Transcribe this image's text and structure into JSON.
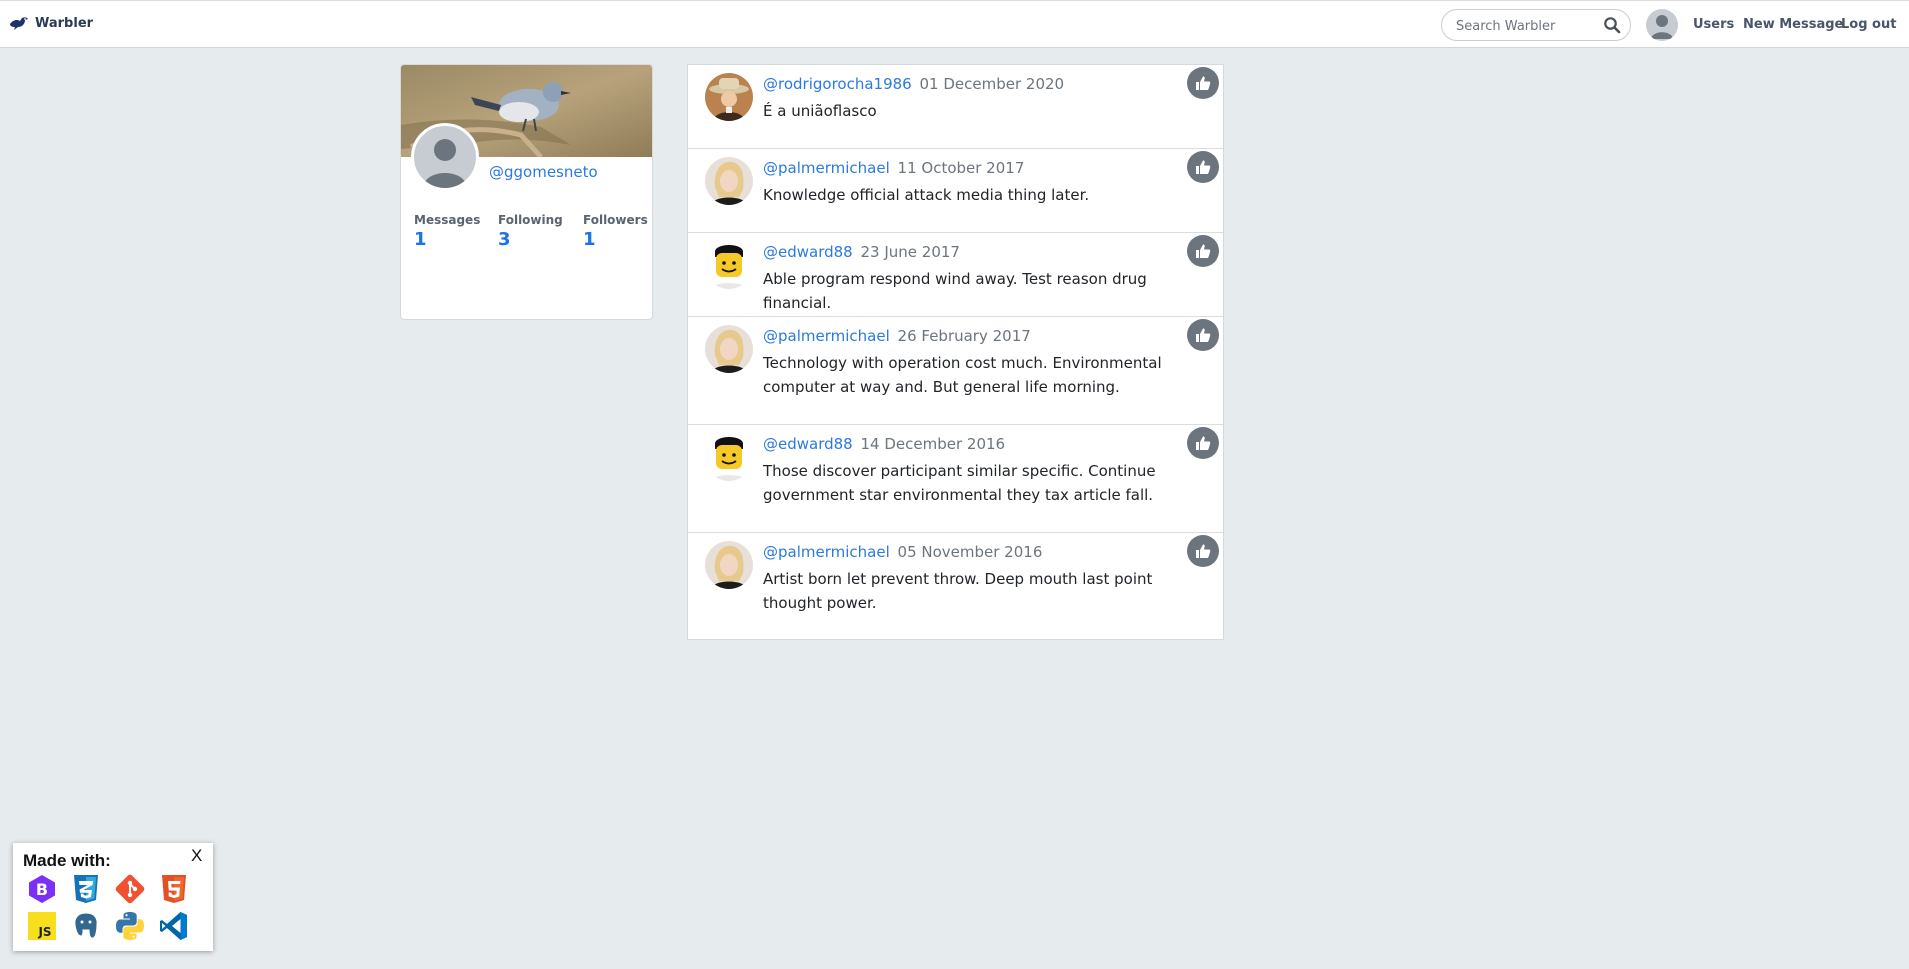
{
  "navbar": {
    "brand": "Warbler",
    "search_placeholder": "Search Warbler",
    "links": {
      "users": "Users",
      "new_message": "New Message",
      "logout": "Log out"
    }
  },
  "profile": {
    "username": "@ggomesneto",
    "stats": [
      {
        "label": "Messages",
        "value": "1"
      },
      {
        "label": "Following",
        "value": "3"
      },
      {
        "label": "Followers",
        "value": "1"
      }
    ]
  },
  "messages": [
    {
      "user": "@rodrigorocha1986",
      "date": "01 December 2020",
      "text": "É a uniãoflasco",
      "avatar": "cowboy-hat-avatar"
    },
    {
      "user": "@palmermichael",
      "date": "11 October 2017",
      "text": "Knowledge official attack media thing later.",
      "avatar": "blonde-woman-avatar"
    },
    {
      "user": "@edward88",
      "date": "23 June 2017",
      "text": "Able program respond wind away. Test reason drug financial.",
      "avatar": "lego-minifigure-avatar"
    },
    {
      "user": "@palmermichael",
      "date": "26 February 2017",
      "text": "Technology with operation cost much. Environmental computer at way and. But general life morning.",
      "avatar": "blonde-woman-avatar"
    },
    {
      "user": "@edward88",
      "date": "14 December 2016",
      "text": "Those discover participant similar specific. Continue government star environmental they tax article fall.",
      "avatar": "lego-minifigure-avatar"
    },
    {
      "user": "@palmermichael",
      "date": "05 November 2016",
      "text": "Artist born let prevent throw. Deep mouth last point thought power.",
      "avatar": "blonde-woman-avatar"
    }
  ],
  "made_with": {
    "title": "Made with:",
    "close": "X",
    "icons": [
      "bootstrap-icon",
      "css3-icon",
      "git-icon",
      "html5-icon",
      "javascript-icon",
      "postgresql-icon",
      "python-icon",
      "vscode-icon"
    ],
    "js_label": "JS",
    "bootstrap_label": "B"
  },
  "colors": {
    "accent": "#2a7ae2",
    "background": "#e6ebee",
    "like": "#6c757d"
  }
}
